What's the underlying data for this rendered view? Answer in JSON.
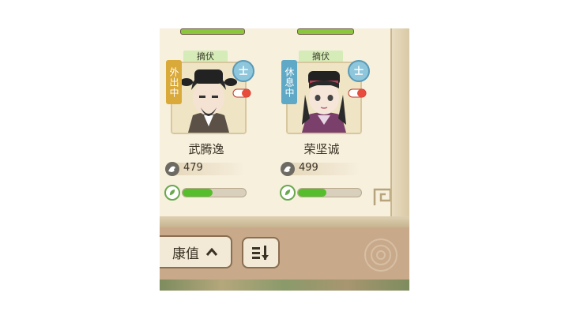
{
  "cards": [
    {
      "title_tag": "摘伏",
      "status": "外出中",
      "status_color": "#d9a93a",
      "rank": "士",
      "name": "武腾逸",
      "stat_value": "479",
      "bar_fill_pct": 48,
      "portrait": "male-official-avatar"
    },
    {
      "title_tag": "摘伏",
      "status": "休息中",
      "status_color": "#5fa8c6",
      "rank": "士",
      "name": "荣坚诚",
      "stat_value": "499",
      "bar_fill_pct": 45,
      "portrait": "female-official-avatar"
    }
  ],
  "sort_button": {
    "label": "康值",
    "icon": "chevron-up-icon"
  },
  "order_button": {
    "icon": "sort-order-icon"
  }
}
